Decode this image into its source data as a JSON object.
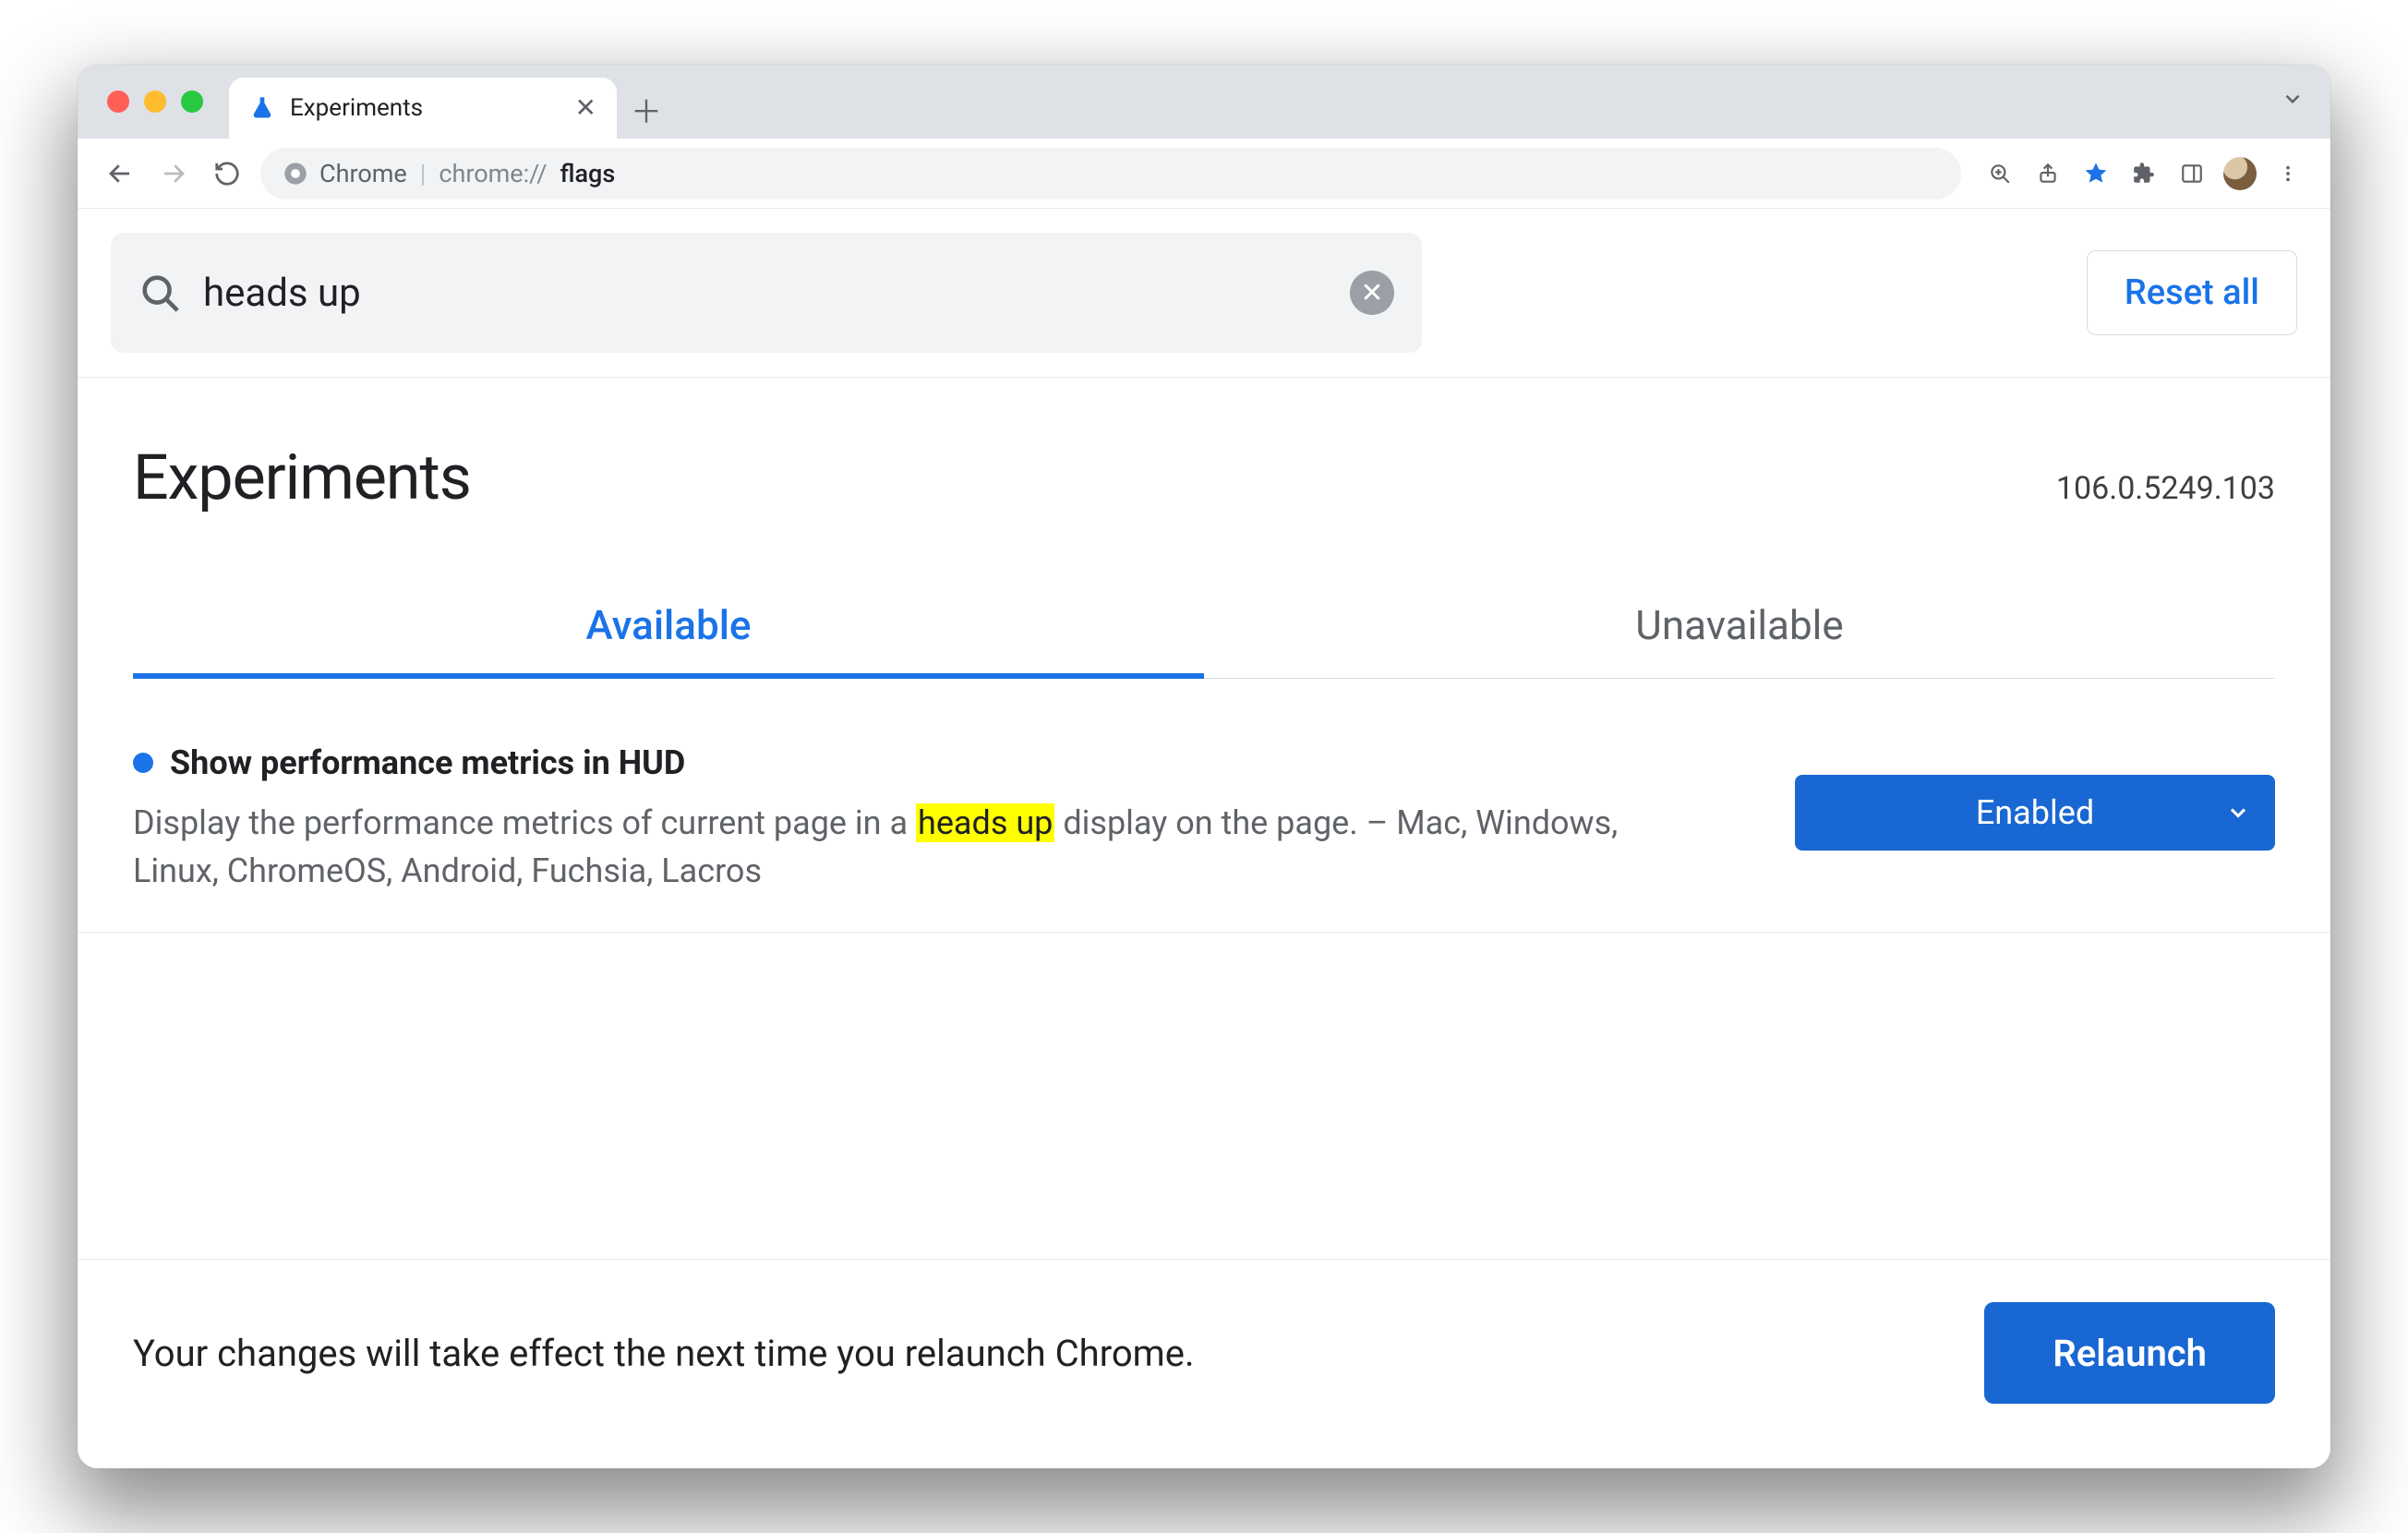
{
  "browser": {
    "tab_title": "Experiments",
    "url_chip_label": "Chrome",
    "url_prefix": "chrome://",
    "url_path": "flags"
  },
  "search": {
    "value": "heads up",
    "reset_label": "Reset all"
  },
  "header": {
    "title": "Experiments",
    "version": "106.0.5249.103"
  },
  "tabs": {
    "available": "Available",
    "unavailable": "Unavailable"
  },
  "flag": {
    "title": "Show performance metrics in HUD",
    "desc_before": "Display the performance metrics of current page in a ",
    "desc_highlight": "heads up",
    "desc_after": " display on the page. – Mac, Windows, Linux, ChromeOS, Android, Fuchsia, Lacros",
    "state": "Enabled"
  },
  "relaunch": {
    "message": "Your changes will take effect the next time you relaunch Chrome.",
    "button": "Relaunch"
  }
}
